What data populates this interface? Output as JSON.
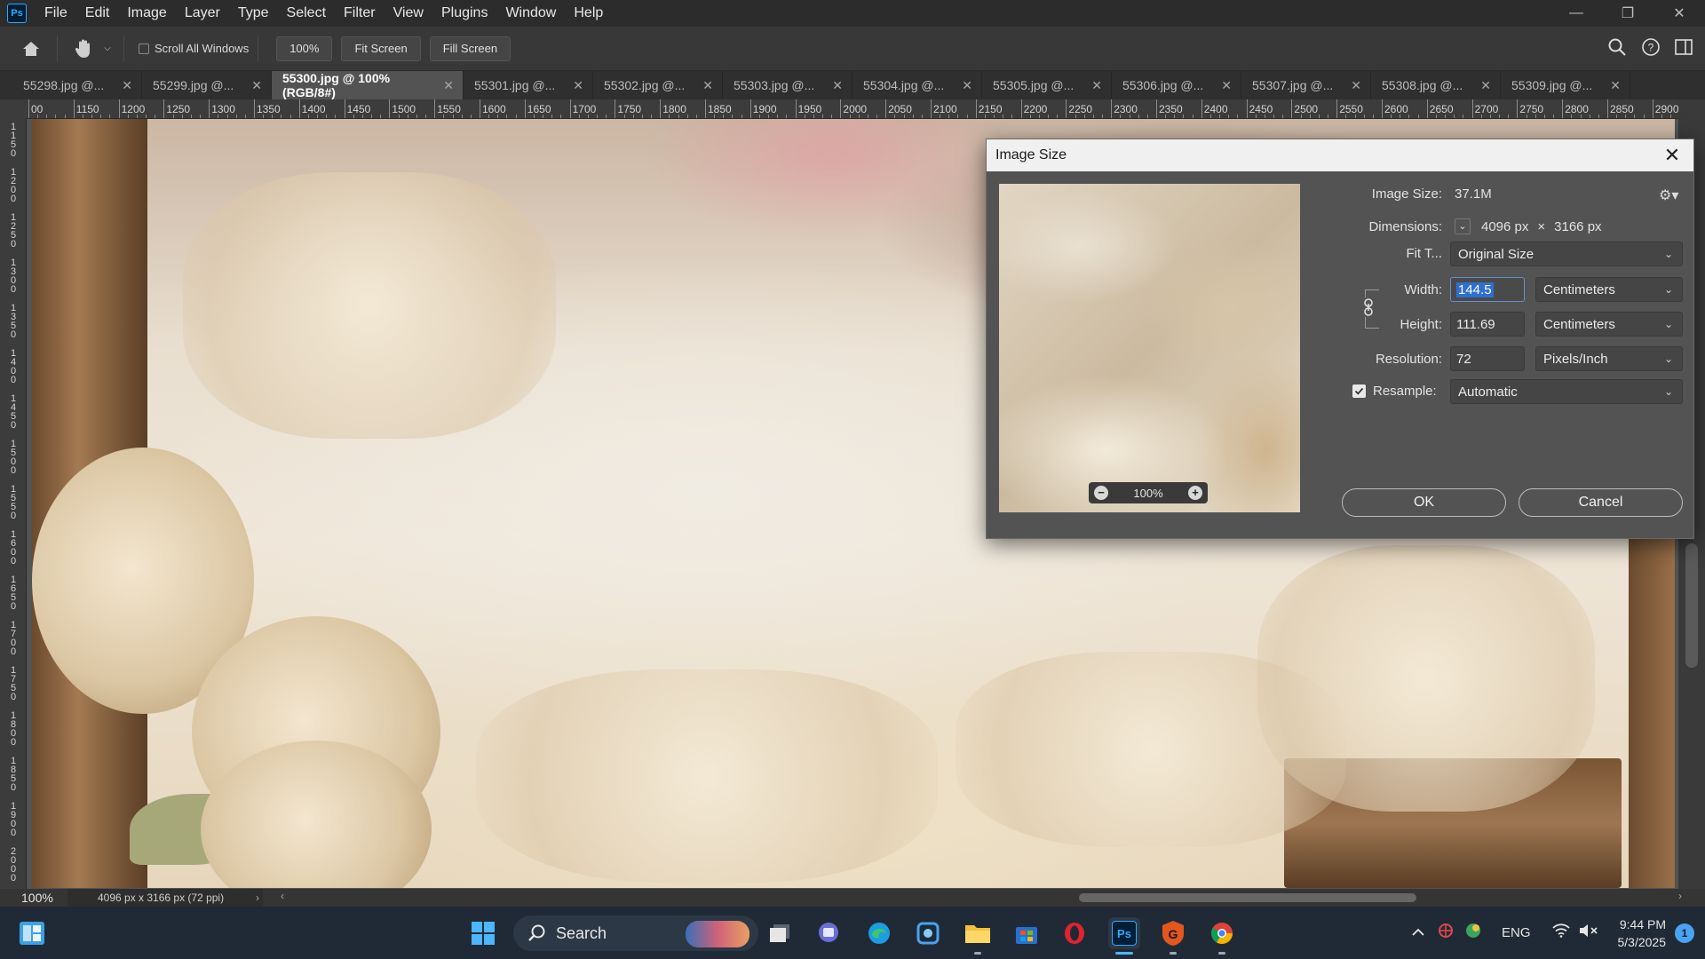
{
  "menubar": {
    "logo": "Ps",
    "items": [
      "File",
      "Edit",
      "Image",
      "Layer",
      "Type",
      "Select",
      "Filter",
      "View",
      "Plugins",
      "Window",
      "Help"
    ]
  },
  "options": {
    "scroll_all_windows": "Scroll All Windows",
    "zoom_value": "100%",
    "fit_screen": "Fit Screen",
    "fill_screen": "Fill Screen"
  },
  "tabs": [
    {
      "label": "55298.jpg @..."
    },
    {
      "label": "55299.jpg @..."
    },
    {
      "label": "55300.jpg @ 100% (RGB/8#)",
      "active": true
    },
    {
      "label": "55301.jpg @..."
    },
    {
      "label": "55302.jpg @..."
    },
    {
      "label": "55303.jpg @..."
    },
    {
      "label": "55304.jpg @..."
    },
    {
      "label": "55305.jpg @..."
    },
    {
      "label": "55306.jpg @..."
    },
    {
      "label": "55307.jpg @..."
    },
    {
      "label": "55308.jpg @..."
    },
    {
      "label": "55309.jpg @..."
    }
  ],
  "ruler_top": [
    "00",
    "1150",
    "1200",
    "1250",
    "1300",
    "1350",
    "1400",
    "1450",
    "1500",
    "1550",
    "1600",
    "1650",
    "1700",
    "1750",
    "1800",
    "1850",
    "1900",
    "1950",
    "2000",
    "2050",
    "2100",
    "2150",
    "2200",
    "2250",
    "2300",
    "2350",
    "2400",
    "2450",
    "2500",
    "2550",
    "2600",
    "2650",
    "2700",
    "2750",
    "2800",
    "2850",
    "2900",
    "295"
  ],
  "ruler_left": [
    "1150",
    "1200",
    "1250",
    "1300",
    "1350",
    "1400",
    "1450",
    "1500",
    "1550",
    "1600",
    "1650",
    "1700",
    "1750",
    "1800",
    "1850",
    "1900",
    "2000"
  ],
  "status": {
    "zoom": "100%",
    "doc_info": "4096 px x 3166 px (72 ppi)"
  },
  "dialog": {
    "title": "Image Size",
    "preview_zoom": "100%",
    "image_size_label": "Image Size:",
    "image_size_value": "37.1M",
    "dimensions_label": "Dimensions:",
    "dim_width": "4096 px",
    "dim_x": "×",
    "dim_height": "3166 px",
    "fit_to_label": "Fit T...",
    "fit_to_value": "Original Size",
    "width_label": "Width:",
    "width_value": "144.5",
    "width_unit": "Centimeters",
    "height_label": "Height:",
    "height_value": "111.69",
    "height_unit": "Centimeters",
    "resolution_label": "Resolution:",
    "resolution_value": "72",
    "resolution_unit": "Pixels/Inch",
    "resample_label": "Resample:",
    "resample_value": "Automatic",
    "ok": "OK",
    "cancel": "Cancel"
  },
  "taskbar": {
    "search": "Search",
    "lang": "ENG",
    "time": "9:44 PM",
    "date": "5/3/2025",
    "notifications": "1"
  }
}
